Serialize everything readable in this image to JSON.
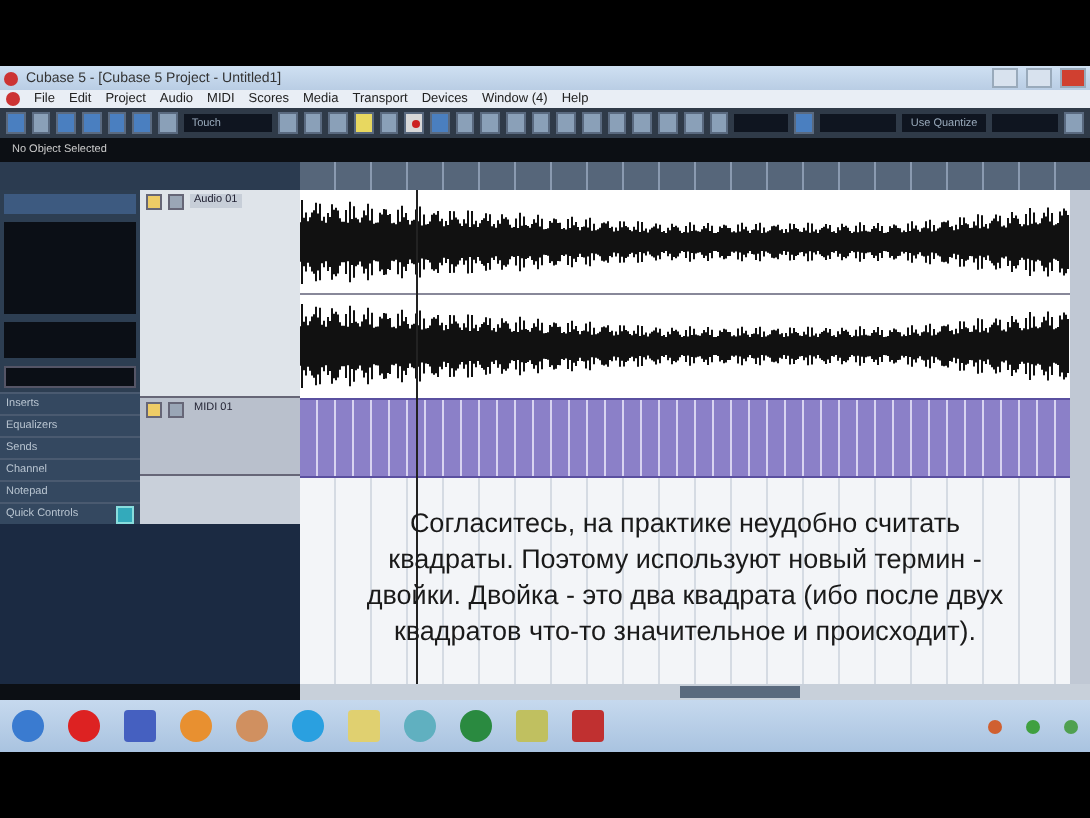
{
  "window": {
    "title": "Cubase 5 - [Cubase 5 Project - Untitled1]"
  },
  "menu": [
    "File",
    "Edit",
    "Project",
    "Audio",
    "MIDI",
    "Scores",
    "Media",
    "Transport",
    "Devices",
    "Window (4)",
    "Help"
  ],
  "toolbar": {
    "automation_mode": "Touch",
    "quantize": "Use Quantize"
  },
  "info_line": "No Object Selected",
  "inspector": {
    "sections": [
      "Inserts",
      "Equalizers",
      "Sends",
      "Channel",
      "Notepad",
      "Quick Controls"
    ]
  },
  "tracks": [
    {
      "kind": "audio",
      "name": "Audio 01"
    },
    {
      "kind": "midi",
      "name": "MIDI 01"
    }
  ],
  "subtitle": "Согласитесь, на практике неудобно считать квадраты. Поэтому используют новый термин - двойки. Двойка - это два квадрата (ибо после двух квадратов что-то значительное и происходит)."
}
